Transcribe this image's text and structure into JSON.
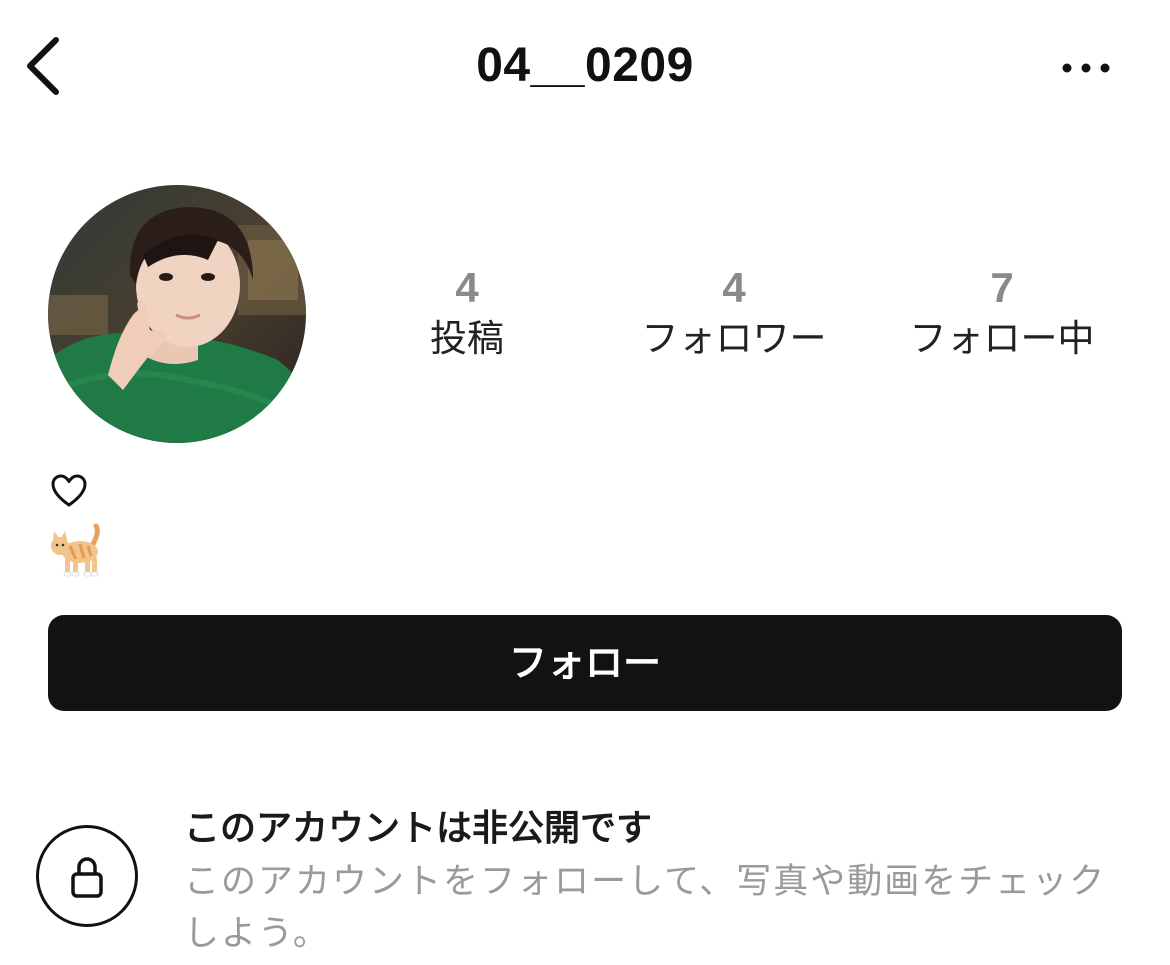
{
  "header": {
    "title": "04__0209",
    "back_icon": "chevron-left-icon",
    "more_icon": "more-horizontal-icon"
  },
  "profile": {
    "avatar": "profile-photo",
    "stats": [
      {
        "value": "4",
        "label": "投稿"
      },
      {
        "value": "4",
        "label": "フォロワー"
      },
      {
        "value": "7",
        "label": "フォロー中"
      }
    ],
    "bio": {
      "line1_icon": "heart-outline-icon",
      "line2_icon": "cat-emoji-icon"
    }
  },
  "actions": {
    "follow_label": "フォロー"
  },
  "private_notice": {
    "icon": "lock-icon",
    "title": "このアカウントは非公開です",
    "description": "このアカウントをフォローして、写真や動画をチェックしよう。"
  },
  "colors": {
    "button_bg": "#121212",
    "stat_number": "#8a8a8a",
    "secondary_text": "#9a9a9a"
  }
}
